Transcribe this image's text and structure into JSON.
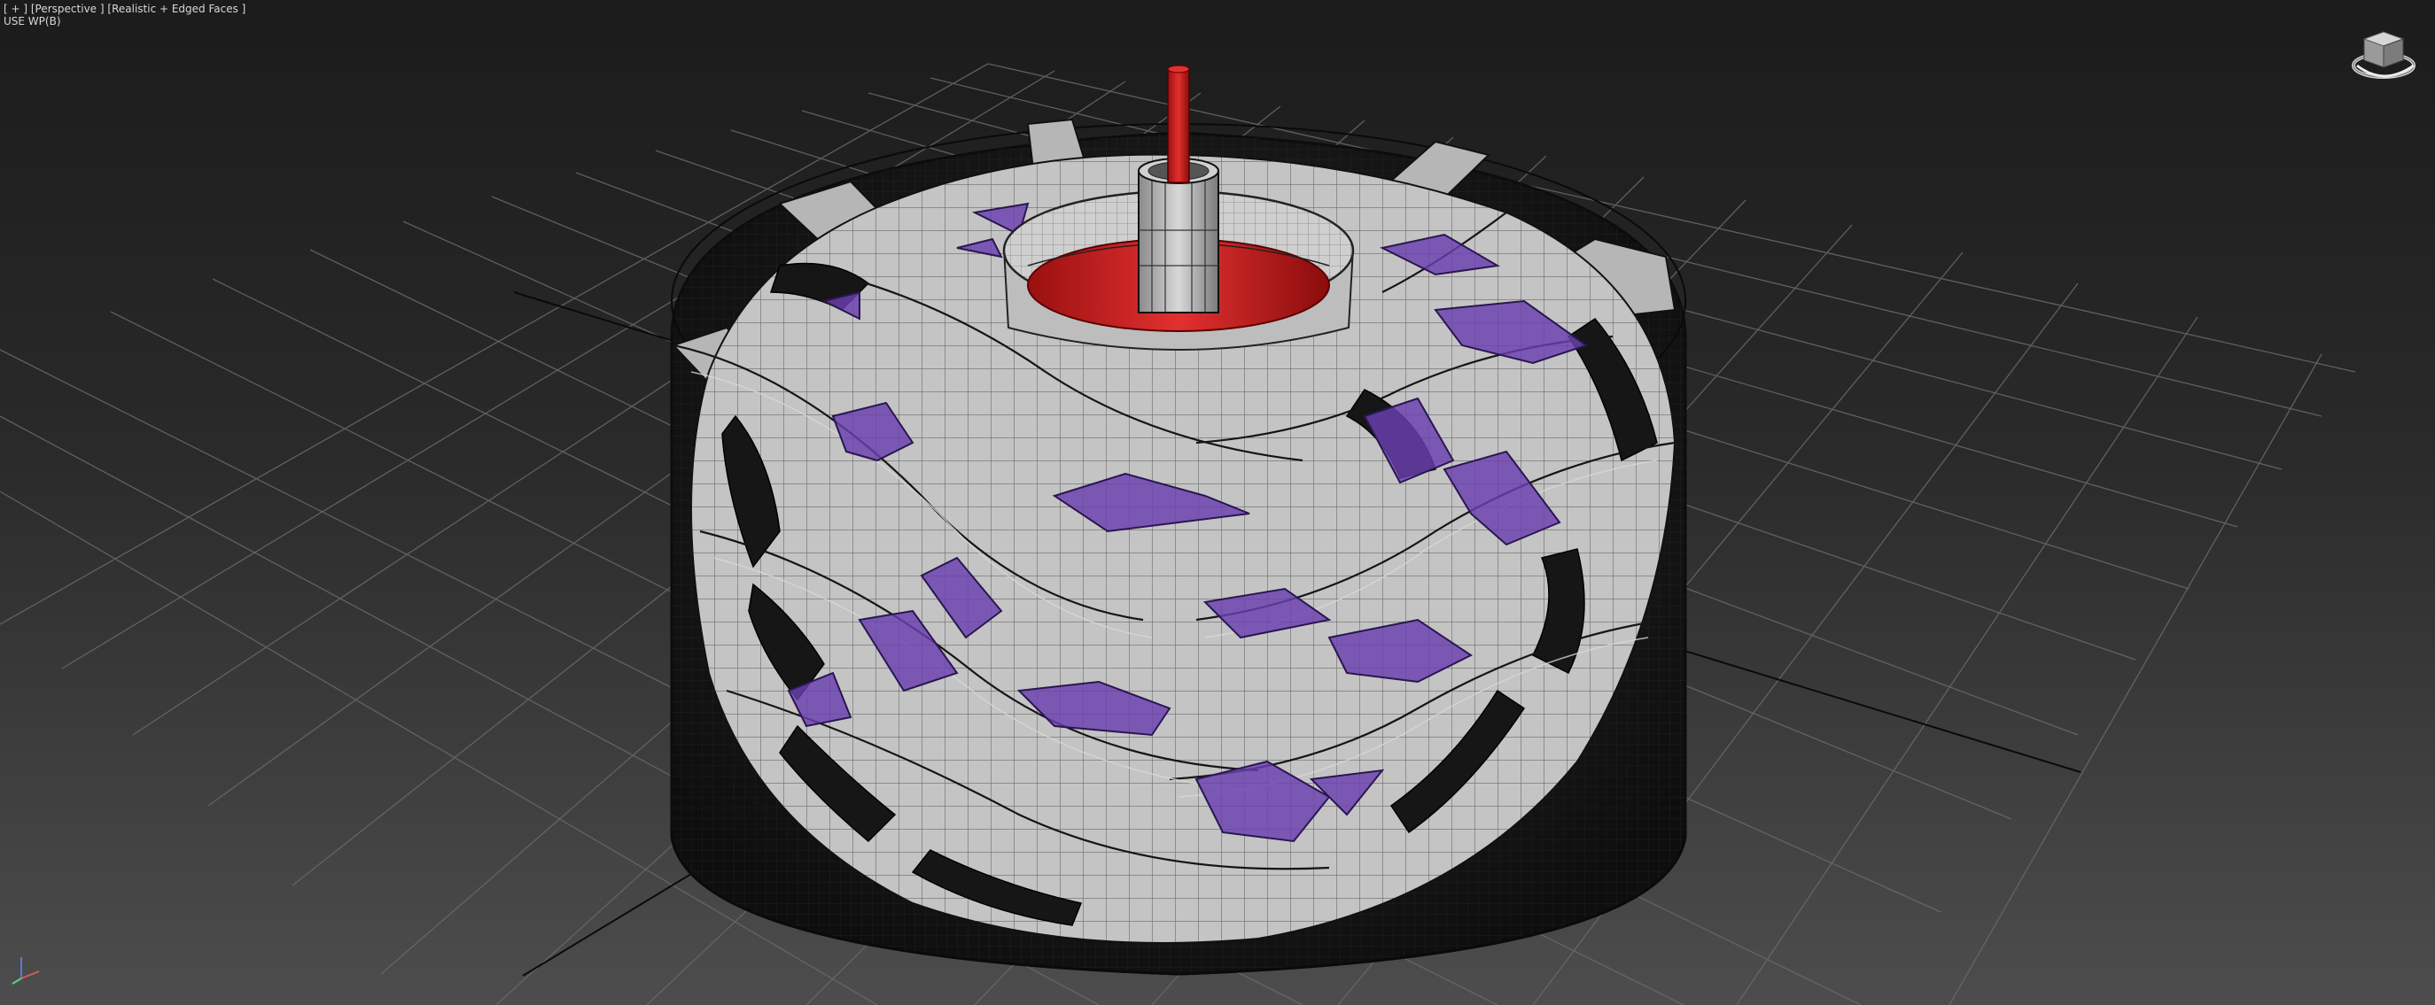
{
  "viewport": {
    "menu": "[ + ]",
    "view": "[Perspective ]",
    "shading": "[Realistic + Edged Faces ]",
    "status": "USE WP(B)"
  },
  "viewcube": {
    "icon": "viewcube-icon"
  },
  "axis_tripod": {
    "icon": "axis-tripod-icon"
  },
  "scene": {
    "object": "impeller-turbine-model",
    "colors": {
      "blade": "#c4c4c4",
      "hub_disk": "#d42a2a",
      "shaft": "#cf1f1f",
      "vane": "#6a3fb0",
      "wire": "#1a1a1a",
      "grid": "#6a6a6a"
    }
  }
}
